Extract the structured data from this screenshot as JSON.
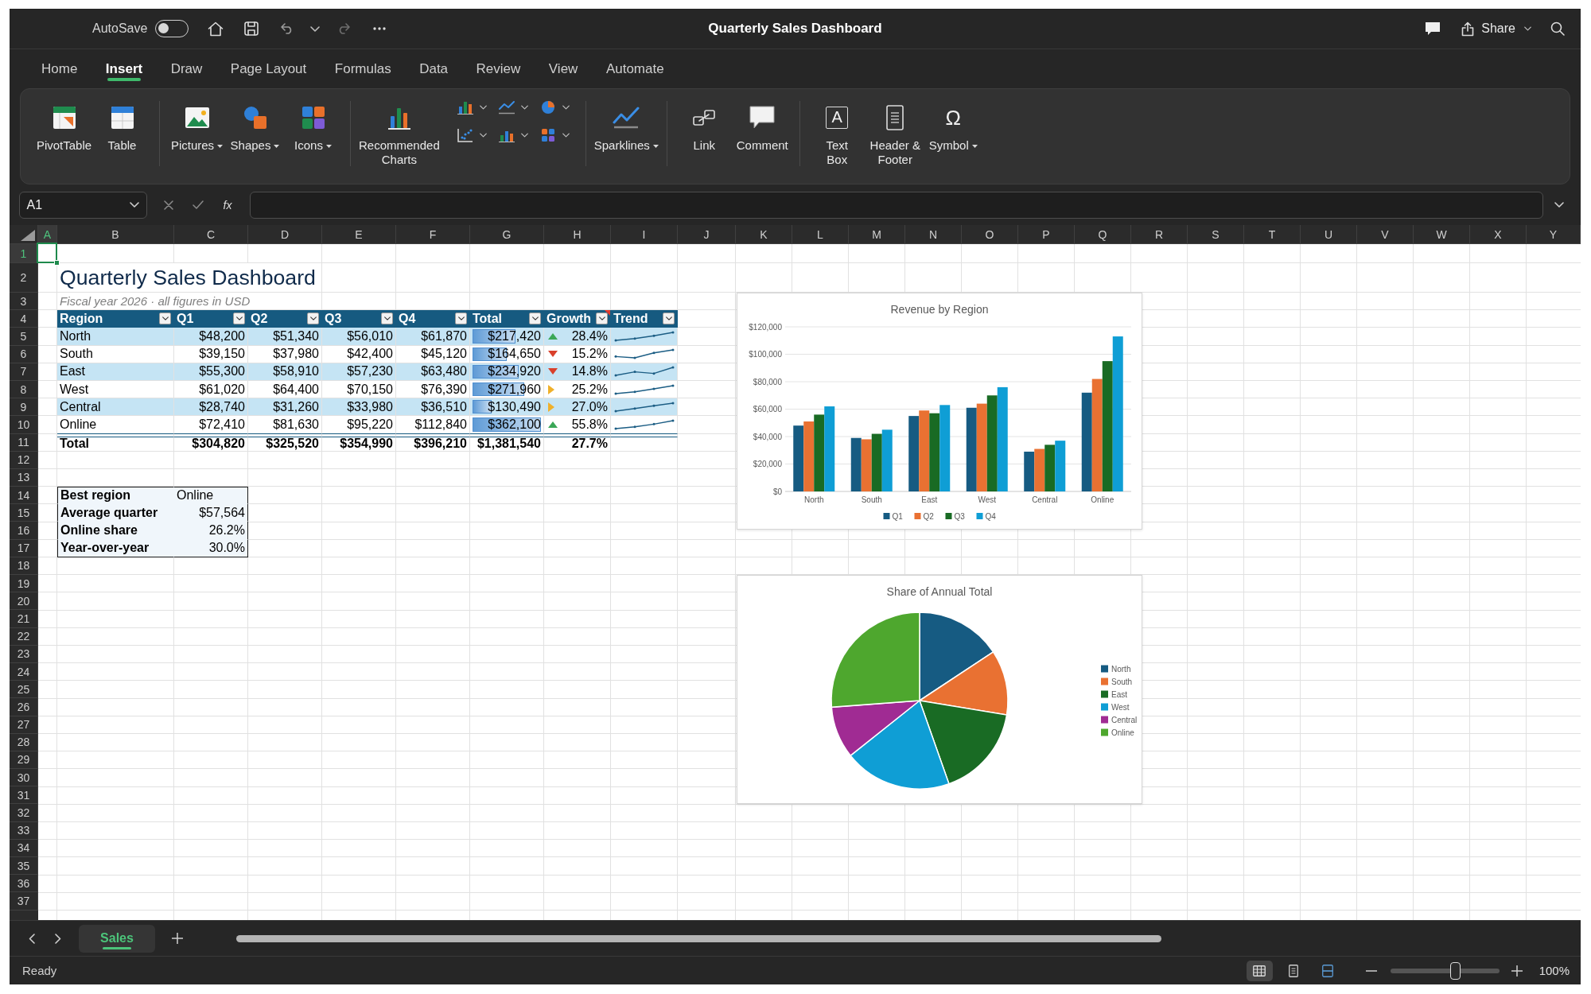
{
  "title_bar": {
    "autosave_label": "AutoSave",
    "autosave_on": false,
    "title": "Quarterly Sales Dashboard",
    "share_label": "Share"
  },
  "ribbon_tabs": [
    {
      "label": "Home",
      "selected": false
    },
    {
      "label": "Insert",
      "selected": true
    },
    {
      "label": "Draw",
      "selected": false
    },
    {
      "label": "Page Layout",
      "selected": false
    },
    {
      "label": "Formulas",
      "selected": false
    },
    {
      "label": "Data",
      "selected": false
    },
    {
      "label": "Review",
      "selected": false
    },
    {
      "label": "View",
      "selected": false
    },
    {
      "label": "Automate",
      "selected": false
    }
  ],
  "ribbon": {
    "groups": [
      {
        "kind": "plain",
        "buttons": [
          {
            "label": "PivotTable",
            "menu": false
          },
          {
            "label": "Table",
            "menu": false
          }
        ]
      },
      {
        "kind": "plain",
        "buttons": [
          {
            "label": "Pictures",
            "menu": true
          },
          {
            "label": "Shapes",
            "menu": true
          },
          {
            "label": "Icons",
            "menu": true
          }
        ]
      },
      {
        "kind": "charts",
        "buttons": [
          {
            "label": "Recommended\nCharts",
            "menu": false
          }
        ]
      },
      {
        "kind": "plain",
        "buttons": [
          {
            "label": "Sparklines",
            "menu": true
          }
        ]
      },
      {
        "kind": "plain",
        "buttons": [
          {
            "label": "Link",
            "menu": false
          },
          {
            "label": "Comment",
            "menu": false
          }
        ]
      },
      {
        "kind": "plain",
        "buttons": [
          {
            "label": "Text\nBox",
            "menu": false,
            "glyph": "A",
            "framed": true
          },
          {
            "label": "Header &\nFooter",
            "menu": false
          },
          {
            "label": "Symbol",
            "menu": true,
            "glyph": "Ω",
            "framed": false
          }
        ]
      }
    ]
  },
  "formula_bar": {
    "name_box": "A1",
    "fx_label": "fx"
  },
  "sheet": {
    "column_headers": [
      {
        "label": "A",
        "selected": true
      },
      {
        "label": "B",
        "selected": false
      },
      {
        "label": "C",
        "selected": false
      },
      {
        "label": "D",
        "selected": false
      },
      {
        "label": "E",
        "selected": false
      },
      {
        "label": "F",
        "selected": false
      },
      {
        "label": "G",
        "selected": false
      },
      {
        "label": "H",
        "selected": false
      },
      {
        "label": "I",
        "selected": false
      },
      {
        "label": "J",
        "selected": false
      },
      {
        "label": "K",
        "selected": false
      },
      {
        "label": "L",
        "selected": false
      },
      {
        "label": "M",
        "selected": false
      },
      {
        "label": "N",
        "selected": false
      },
      {
        "label": "O",
        "selected": false
      },
      {
        "label": "P",
        "selected": false
      },
      {
        "label": "Q",
        "selected": false
      },
      {
        "label": "R",
        "selected": false
      },
      {
        "label": "S",
        "selected": false
      },
      {
        "label": "T",
        "selected": false
      },
      {
        "label": "U",
        "selected": false
      },
      {
        "label": "V",
        "selected": false
      },
      {
        "label": "W",
        "selected": false
      },
      {
        "label": "X",
        "selected": false
      },
      {
        "label": "Y",
        "selected": false
      }
    ],
    "row_headers": [
      {
        "label": "1",
        "selected": true
      },
      {
        "label": "2",
        "selected": false
      },
      {
        "label": "3",
        "selected": false
      },
      {
        "label": "4",
        "selected": false
      },
      {
        "label": "5",
        "selected": false
      },
      {
        "label": "6",
        "selected": false
      },
      {
        "label": "7",
        "selected": false
      },
      {
        "label": "8",
        "selected": false
      },
      {
        "label": "9",
        "selected": false
      },
      {
        "label": "10",
        "selected": false
      },
      {
        "label": "11",
        "selected": false
      },
      {
        "label": "12",
        "selected": false
      },
      {
        "label": "13",
        "selected": false
      },
      {
        "label": "14",
        "selected": false
      },
      {
        "label": "15",
        "selected": false
      },
      {
        "label": "16",
        "selected": false
      },
      {
        "label": "17",
        "selected": false
      },
      {
        "label": "18",
        "selected": false
      },
      {
        "label": "19",
        "selected": false
      },
      {
        "label": "20",
        "selected": false
      },
      {
        "label": "21",
        "selected": false
      },
      {
        "label": "22",
        "selected": false
      },
      {
        "label": "23",
        "selected": false
      },
      {
        "label": "24",
        "selected": false
      },
      {
        "label": "25",
        "selected": false
      },
      {
        "label": "26",
        "selected": false
      },
      {
        "label": "27",
        "selected": false
      },
      {
        "label": "28",
        "selected": false
      },
      {
        "label": "29",
        "selected": false
      },
      {
        "label": "30",
        "selected": false
      },
      {
        "label": "31",
        "selected": false
      },
      {
        "label": "32",
        "selected": false
      },
      {
        "label": "33",
        "selected": false
      },
      {
        "label": "34",
        "selected": false
      },
      {
        "label": "35",
        "selected": false
      },
      {
        "label": "36",
        "selected": false
      },
      {
        "label": "37",
        "selected": false
      }
    ],
    "title": "Quarterly Sales Dashboard",
    "subtitle": "Fiscal year 2026 · all figures in USD",
    "table": {
      "columns": [
        {
          "label": "Region",
          "comment": false
        },
        {
          "label": "Q1",
          "comment": false
        },
        {
          "label": "Q2",
          "comment": false
        },
        {
          "label": "Q3",
          "comment": false
        },
        {
          "label": "Q4",
          "comment": false
        },
        {
          "label": "Total",
          "comment": false
        },
        {
          "label": "Growth",
          "comment": true
        },
        {
          "label": "Trend",
          "comment": false
        }
      ],
      "rows": [
        {
          "cells": [
            "North",
            "$48,200",
            "$51,340",
            "$56,010",
            "$61,870",
            "$217,420",
            "28.4%"
          ],
          "level": 0.63,
          "kind": "up"
        },
        {
          "cells": [
            "South",
            "$39,150",
            "$37,980",
            "$42,400",
            "$45,120",
            "$164,650",
            "15.2%"
          ],
          "level": 0.5,
          "kind": "down"
        },
        {
          "cells": [
            "East",
            "$55,300",
            "$58,910",
            "$57,230",
            "$63,480",
            "$234,920",
            "14.8%"
          ],
          "level": 0.67,
          "kind": "down"
        },
        {
          "cells": [
            "West",
            "$61,020",
            "$64,400",
            "$70,150",
            "$76,390",
            "$271,960",
            "25.2%"
          ],
          "level": 0.76,
          "kind": "side"
        },
        {
          "cells": [
            "Central",
            "$28,740",
            "$31,260",
            "$33,980",
            "$36,510",
            "$130,490",
            "27.0%"
          ],
          "level": 0.28,
          "kind": "side"
        },
        {
          "cells": [
            "Online",
            "$72,410",
            "$81,630",
            "$95,220",
            "$112,840",
            "$362,100",
            "55.8%"
          ],
          "level": 1.0,
          "kind": "up"
        }
      ],
      "total_row": {
        "cells": [
          "Total",
          "$304,820",
          "$325,520",
          "$354,990",
          "$396,210",
          "$1,381,540",
          "27.7%"
        ]
      }
    },
    "summary": [
      {
        "label": "Best region",
        "value": "Online",
        "kind": "text"
      },
      {
        "label": "Average quarter",
        "value": "$57,564",
        "kind": "number"
      },
      {
        "label": "Online share",
        "value": "26.2%",
        "kind": "number"
      },
      {
        "label": "Year-over-year",
        "value": "30.0%",
        "kind": "number"
      }
    ],
    "charts": [
      {
        "chart_data": {
          "type": "bar",
          "title": "Revenue by Region",
          "categories": [
            "North",
            "South",
            "East",
            "West",
            "Central",
            "Online"
          ],
          "series": [
            {
              "name": "Q1",
              "color": "#165b82",
              "values": [
                48000,
                39000,
                55000,
                61000,
                29000,
                72000
              ]
            },
            {
              "name": "Q2",
              "color": "#e97132",
              "values": [
                51000,
                38000,
                59000,
                64000,
                31000,
                82000
              ]
            },
            {
              "name": "Q3",
              "color": "#196b24",
              "values": [
                56000,
                42000,
                57000,
                70000,
                34000,
                95000
              ]
            },
            {
              "name": "Q4",
              "color": "#0f9ed5",
              "values": [
                62000,
                45000,
                63000,
                76000,
                37000,
                113000
              ]
            }
          ],
          "ylim": [
            0,
            120000
          ],
          "yticks": [
            {
              "value": 0,
              "label": "$0"
            },
            {
              "value": 20000,
              "label": "$20,000"
            },
            {
              "value": 40000,
              "label": "$40,000"
            },
            {
              "value": 60000,
              "label": "$60,000"
            },
            {
              "value": 80000,
              "label": "$80,000"
            },
            {
              "value": 100000,
              "label": "$100,000"
            },
            {
              "value": 120000,
              "label": "$120,000"
            }
          ],
          "grid": true,
          "legend": "bottom"
        }
      },
      {
        "chart_data": {
          "type": "pie",
          "title": "Share of Annual Total",
          "categories": [
            "North",
            "South",
            "East",
            "West",
            "Central",
            "Online"
          ],
          "values": [
            15.7,
            11.9,
            17.0,
            19.7,
            9.5,
            26.2
          ],
          "colors": [
            "#165b82",
            "#e97132",
            "#196b24",
            "#0f9ed5",
            "#a02b93",
            "#4ea72e"
          ],
          "legend": "right"
        }
      }
    ]
  },
  "sheet_tabs": [
    {
      "label": "Sales",
      "selected": true
    }
  ],
  "status_bar": {
    "status": "Ready",
    "views": [
      {
        "kind": "normal",
        "selected": true
      },
      {
        "kind": "page_layout",
        "selected": false
      },
      {
        "kind": "page_break",
        "selected": false
      }
    ],
    "zoom": {
      "level": 0.6,
      "reading": "100%"
    }
  }
}
